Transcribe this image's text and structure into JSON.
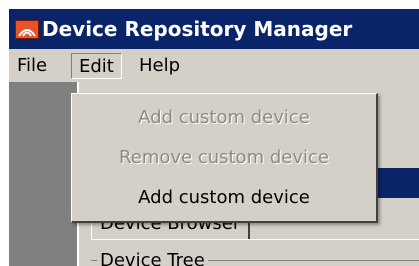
{
  "window": {
    "title": "Device Repository Manager",
    "icon": "app-logo-icon"
  },
  "menubar": {
    "items": [
      {
        "label": "File"
      },
      {
        "label": "Edit"
      },
      {
        "label": "Help"
      }
    ]
  },
  "edit_menu": {
    "open": true,
    "items": [
      {
        "label": "Add custom device",
        "enabled": false
      },
      {
        "label": "Remove custom device",
        "enabled": false
      },
      {
        "label": "Add custom device",
        "enabled": true
      }
    ]
  },
  "content": {
    "tab_label": "Device Browser",
    "group_label": "Device Tree"
  },
  "colors": {
    "titlebar": "#0a246a",
    "face": "#d4d0c8",
    "disabled_text": "#8c8a84"
  }
}
